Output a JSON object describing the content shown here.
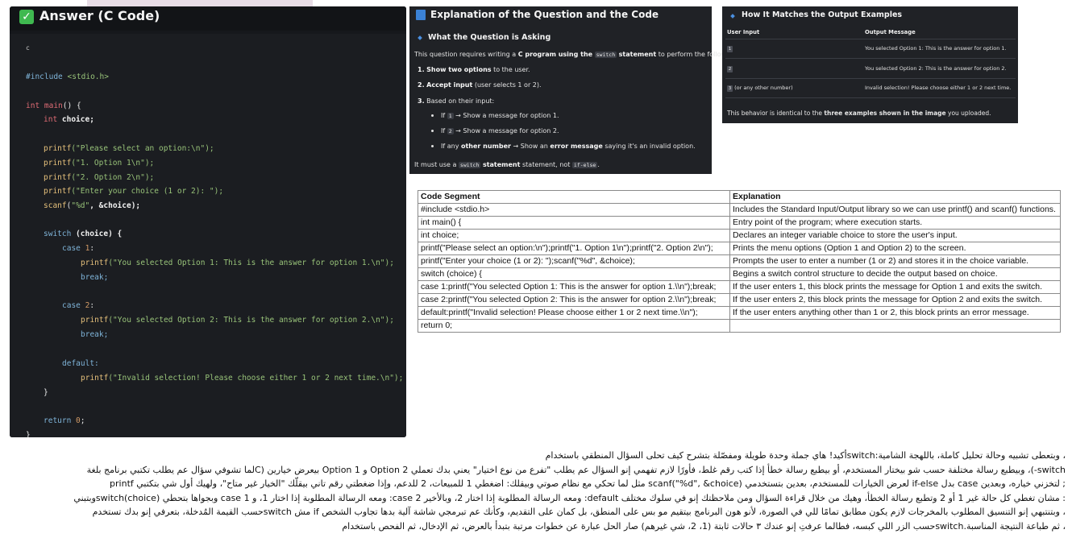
{
  "code_panel": {
    "title": "Answer (C Code)",
    "lang": "c",
    "lines": {
      "l1a": "#include ",
      "l1b": "<stdio.h>",
      "l2a": "int ",
      "l2b": "main",
      "l2c": "() {",
      "l3a": "int ",
      "l3b": "choice;",
      "p1": "printf",
      "p1s": "(\"Please select an option:\\n\");",
      "p2": "printf",
      "p2s": "(\"1. Option 1\\n\");",
      "p3": "printf",
      "p3s": "(\"2. Option 2\\n\");",
      "p4": "printf",
      "p4s": "(\"Enter your choice (1 or 2): \");",
      "s1": "scanf",
      "s1a": "(",
      "s1b": "\"%d\"",
      "s1c": ", &choice);",
      "sw": "switch",
      "swb": " (choice) {",
      "c1": "case ",
      "c1n": "1",
      "c1c": ":",
      "c1p": "printf",
      "c1s": "(\"You selected Option 1: This is the answer for option 1.\\n\");",
      "br1": "break;",
      "c2": "case ",
      "c2n": "2",
      "c2c": ":",
      "c2p": "printf",
      "c2s": "(\"You selected Option 2: This is the answer for option 2.\\n\");",
      "br2": "break;",
      "df": "default:",
      "dfp": "printf",
      "dfs": "(\"Invalid selection! Please choose either 1 or 2 next time.\\n\");",
      "close1": "}",
      "ret": "return ",
      "retn": "0",
      "retc": ";",
      "close2": "}"
    }
  },
  "explanation": {
    "title": "Explanation of the Question and the Code",
    "subtitle": "What the Question is Asking",
    "intro_a": "This question requires writing a ",
    "intro_b": "C program using the",
    "intro_chip": "switch",
    "intro_c": "statement",
    "intro_d": " to perform the following:",
    "step1_num": "1.",
    "step1_b": "Show two options",
    "step1_r": " to the user.",
    "step2_num": "2.",
    "step2_b": "Accept input",
    "step2_r": " (user selects 1 or 2).",
    "step3_num": "3.",
    "step3_r": "Based on their input:",
    "b1_pre": "If ",
    "b1_chip": "1",
    "b1_post": " → Show a message for option 1.",
    "b2_pre": "If ",
    "b2_chip": "2",
    "b2_post": " → Show a message for option 2.",
    "b3_pre": "If any ",
    "b3_b": "other number",
    "b3_mid": " → Show an ",
    "b3_b2": "error message",
    "b3_post": " saying it's an invalid option.",
    "foot_a": "It must use a ",
    "foot_chip1": "switch",
    "foot_b": " statement, not ",
    "foot_chip2": "if-else",
    "foot_c": "."
  },
  "matching": {
    "title": "How It Matches the Output Examples",
    "col1": "User Input",
    "col2": "Output Message",
    "rows": [
      {
        "chip": "1",
        "extra": "",
        "msg": "You selected Option 1: This is the answer for option 1."
      },
      {
        "chip": "2",
        "extra": "",
        "msg": "You selected Option 2: This is the answer for option 2."
      },
      {
        "chip": "3",
        "extra": " (or any other number)",
        "msg": "Invalid selection! Please choose either 1 or 2 next time."
      }
    ],
    "foot_a": "This behavior is identical to the ",
    "foot_b": "three examples shown in the image",
    "foot_c": " you uploaded."
  },
  "table": {
    "headers": [
      "Code Segment",
      "Explanation"
    ],
    "rows": [
      [
        "#include <stdio.h>",
        "Includes the Standard Input/Output library so we can use printf() and scanf() functions."
      ],
      [
        "int main() {",
        "Entry point of the program; where execution starts."
      ],
      [
        "int choice;",
        "Declares an integer variable choice to store the user's input."
      ],
      [
        "printf(\"Please select an option:\\n\");printf(\"1. Option 1\\n\");printf(\"2. Option 2\\n\");",
        "Prints the menu options (Option 1 and Option 2) to the screen."
      ],
      [
        "printf(\"Enter your choice (1 or 2): \");scanf(\"%d\", &choice);",
        "Prompts the user to enter a number (1 or 2) and stores it in the choice variable."
      ],
      [
        "switch (choice) {",
        "Begins a switch control structure to decide the output based on choice."
      ],
      [
        "case 1:printf(\"You selected Option 1: This is the answer for option 1.\\\\n\");break;",
        "If the user enters 1, this block prints the message for Option 1 and exits the switch."
      ],
      [
        "case 2:printf(\"You selected Option 2: This is the answer for option 2.\\\\n\");break;",
        "If the user enters 2, this block prints the message for Option 2 and exits the switch."
      ],
      [
        "default:printf(\"Invalid selection! Please choose either 1 or 2 next time.\\\\n\");",
        "If the user enters anything other than 1 or 2, this block prints an error message."
      ],
      [
        "return 0;",
        ""
      ]
    ]
  },
  "arabic": [
    "، وبتعطى تشبيه وحالة تحليل كاملة، باللهجة الشامية:switchأكيد! هاي جملة وحدة طويلة ومفصّلة بتشرح كيف تحلى السؤال المنطقي باستخدام",
    "switch-)، وبيطبع رسالة مختلفة حسب شو بيختار المستخدم، أو بيطبع رسالة خطأ إذا كتب رقم غلط، فأورًا لازم تفهمي إنو السؤال عم يطلب \"تفرع من نوع اختيار\" يعني بدك تعملي Option 2 و Option 1 بيعرض خيارين (Cلما تشوفي سؤال عم يطلب تكتبي برنامج بلغة",
    "; لتخزني خياره، وبعدين case بدل if-else لعرض الخيارات للمستخدم، بعدين بتستخدمي scanf(\"%d\", &choice) مثل لما تحكي مع نظام صوتي وبيقلك: اضغطي 1 للمبيعات، 2 للدعم، وإذا ضغطتي رقم تاني بيقلّك \"الخيار غير متاح\"، ولهيك أول شي بتكتبي printf",
    ": مشان تغطي كل حالة غير 1 أو 2 وتطبع رسالة الخطأ، وهيك من خلال قراءة السؤال ومن ملاحظتك إنو في سلوك مختلف default: ومعه الرسالة المطلوبة إذا اختار 2، وبالأخير case 2: ومعه الرسالة المطلوبة إذا اختار 1، و case 1 وبجواها بتحطي switch(choice)وبتبني",
    "، وبتنتبهي إنو التنسيق المطلوب بالمخرجات لازم يكون مطابق تمامًا للي في الصورة، لأنو هون البرنامج بيتقيم مو بس على المنطق، بل كمان على التقديم، وكأنك عم تبرمجي شاشة آلية بدها تجاوب الشخص if مش switchحسب القيمة المُدخلة، بتعرفي إنو بدك تستخدم",
    "، ثم طباعة النتيجة المناسبة.switchحسب الزر اللي كبسه، فطالما عرفتِ إنو عندك ٣ حالات ثابتة (1، 2، شي غيرهم) صار الحل عبارة عن خطوات مرتبة بتبدأ بالعرض، ثم الإدخال، ثم الفحص باستخدام"
  ]
}
